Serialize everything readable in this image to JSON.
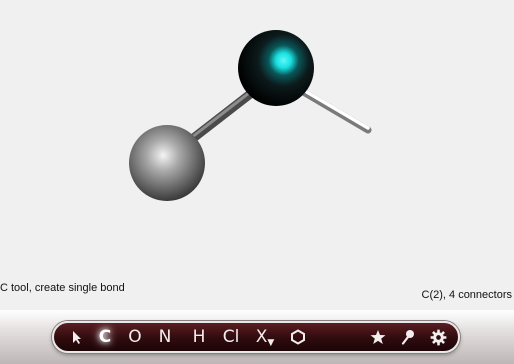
{
  "status": {
    "left": "C tool, create single bond",
    "right": "C(2), 4 connectors"
  },
  "toolbar": {
    "tools": [
      {
        "id": "select",
        "label": "",
        "icon": "arrow-cursor-icon"
      },
      {
        "id": "carbon",
        "label": "C",
        "selected": true
      },
      {
        "id": "oxygen",
        "label": "O"
      },
      {
        "id": "nitrogen",
        "label": "N"
      },
      {
        "id": "hydrogen",
        "label": "H"
      },
      {
        "id": "chlorine",
        "label": "Cl"
      },
      {
        "id": "other-element",
        "label": "X"
      },
      {
        "id": "ring",
        "label": "",
        "icon": "hexagon-ring-icon"
      },
      {
        "id": "favorites",
        "label": "",
        "icon": "star-icon"
      },
      {
        "id": "pin",
        "label": "",
        "icon": "pin-icon"
      },
      {
        "id": "settings",
        "label": "",
        "icon": "gear-icon"
      }
    ]
  },
  "molecule": {
    "atoms": [
      {
        "id": "atom-1",
        "element": "C",
        "color": "#7a7a7a",
        "selected": false
      },
      {
        "id": "atom-2",
        "element": "C",
        "color": "#111111",
        "selected": true,
        "highlight": "#19e0e0"
      }
    ],
    "connector_color": "#ffffff"
  }
}
